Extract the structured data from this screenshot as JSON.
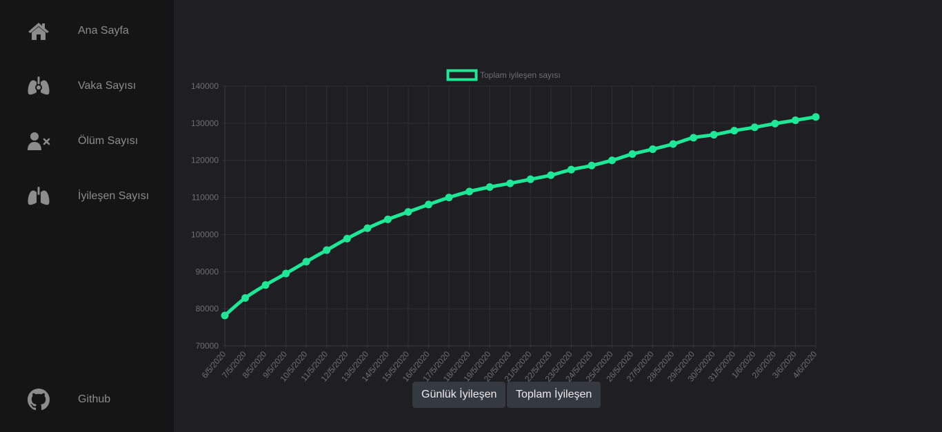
{
  "sidebar": {
    "items": [
      {
        "label": "Ana Sayfa",
        "icon": "home-icon"
      },
      {
        "label": "Vaka Sayısı",
        "icon": "virus-lungs-icon"
      },
      {
        "label": "Ölüm Sayısı",
        "icon": "user-remove-icon"
      },
      {
        "label": "İyileşen Sayısı",
        "icon": "lungs-icon"
      }
    ],
    "footer": {
      "label": "Github",
      "icon": "github-icon"
    }
  },
  "buttons": {
    "daily": "Günlük İyileşen",
    "total": "Toplam İyileşen"
  },
  "colors": {
    "accent": "#1ee896",
    "sidebar_bg": "#151516",
    "main_bg": "#1f1f23",
    "muted_text": "#8c8c8c",
    "button_bg": "#343a40"
  },
  "chart_data": {
    "type": "line",
    "title": "",
    "xlabel": "",
    "ylabel": "",
    "legend": {
      "position": "top",
      "label": "Toplam iyileşen sayısı"
    },
    "grid": true,
    "ylim": [
      70000,
      140000
    ],
    "yticks": [
      140000,
      130000,
      120000,
      110000,
      100000,
      90000,
      80000,
      70000
    ],
    "x": [
      "6/5/2020",
      "7/5/2020",
      "8/5/2020",
      "9/5/2020",
      "10/5/2020",
      "11/5/2020",
      "12/5/2020",
      "13/5/2020",
      "14/5/2020",
      "15/5/2020",
      "16/5/2020",
      "17/5/2020",
      "18/5/2020",
      "19/5/2020",
      "20/5/2020",
      "21/5/2020",
      "22/5/2020",
      "23/5/2020",
      "24/5/2020",
      "25/5/2020",
      "26/5/2020",
      "27/5/2020",
      "28/5/2020",
      "29/5/2020",
      "30/5/2020",
      "31/5/2020",
      "1/6/2020",
      "2/6/2020",
      "3/6/2020",
      "4/6/2020"
    ],
    "series": [
      {
        "name": "Toplam iyileşen sayısı",
        "color": "#1ee896",
        "values": [
          78200,
          82900,
          86400,
          89500,
          92700,
          95800,
          98900,
          101700,
          104100,
          106100,
          108100,
          110000,
          111600,
          112800,
          113800,
          114900,
          116000,
          117500,
          118600,
          120000,
          121700,
          123000,
          124400,
          126100,
          126900,
          128000,
          128900,
          129900,
          130800,
          131700
        ]
      }
    ]
  }
}
